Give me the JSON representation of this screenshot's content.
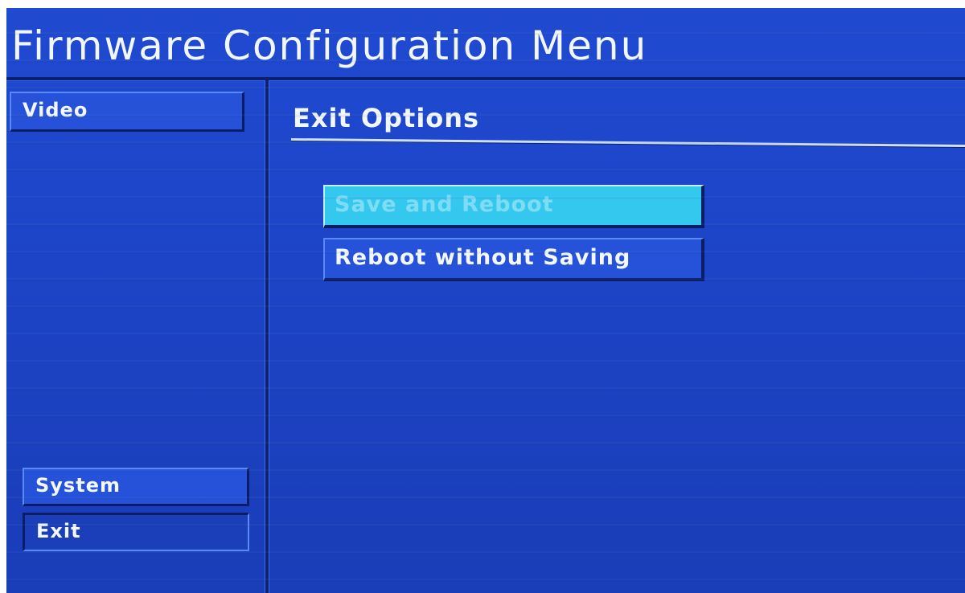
{
  "header": {
    "title": "Firmware Configuration Menu"
  },
  "sidebar": {
    "items": [
      {
        "label": "Video",
        "selected": false
      },
      {
        "label": "System",
        "selected": false
      },
      {
        "label": "Exit",
        "selected": true
      }
    ]
  },
  "main": {
    "section_title": "Exit Options",
    "options": [
      {
        "label": "Save and Reboot",
        "highlighted": true
      },
      {
        "label": "Reboot without Saving",
        "highlighted": false
      }
    ]
  },
  "colors": {
    "background": "#1f4ad1",
    "highlight": "#35c8ef",
    "text": "#f3f7ff"
  }
}
